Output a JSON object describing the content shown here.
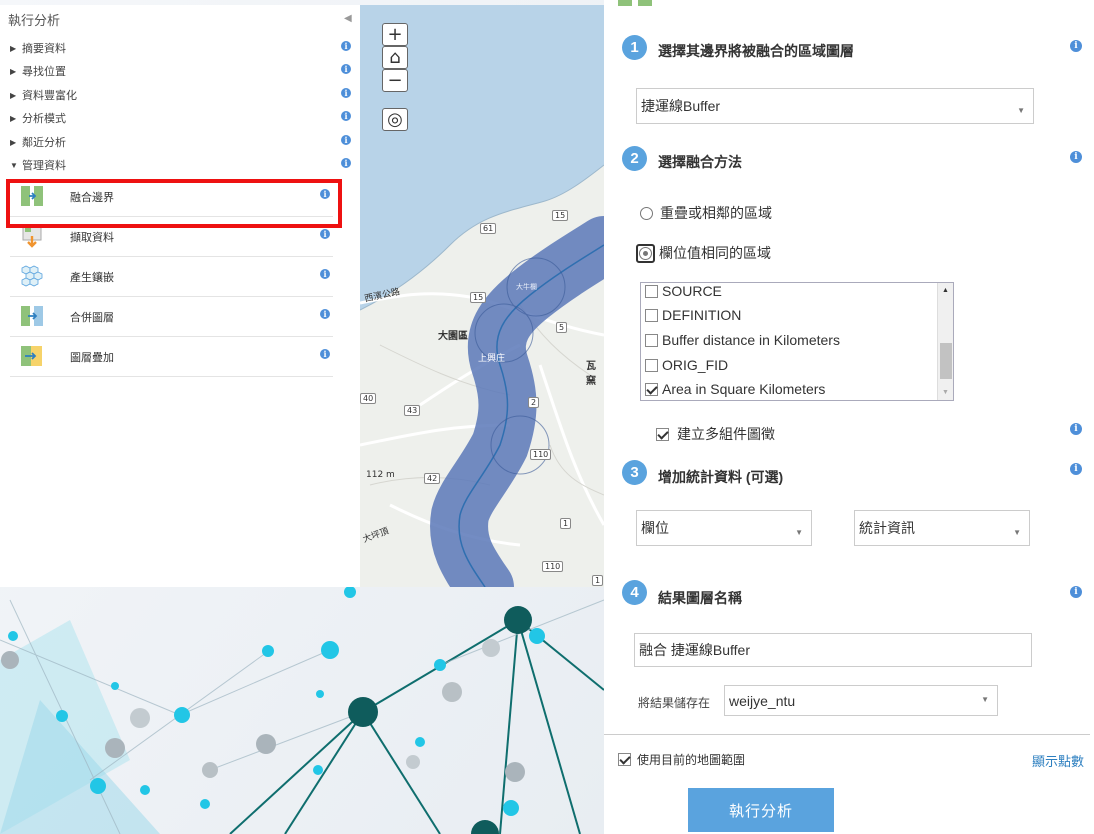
{
  "left_panel": {
    "title": "執行分析",
    "categories": [
      {
        "label": "摘要資料",
        "expanded": false
      },
      {
        "label": "尋找位置",
        "expanded": false
      },
      {
        "label": "資料豐富化",
        "expanded": false
      },
      {
        "label": "分析模式",
        "expanded": false
      },
      {
        "label": "鄰近分析",
        "expanded": false
      },
      {
        "label": "管理資料",
        "expanded": true
      }
    ],
    "tools": [
      {
        "label": "融合邊界",
        "icon": "dissolve-boundaries-icon"
      },
      {
        "label": "擷取資料",
        "icon": "extract-data-icon"
      },
      {
        "label": "產生鑲嵌",
        "icon": "generate-tessellation-icon"
      },
      {
        "label": "合併圖層",
        "icon": "merge-layers-icon"
      },
      {
        "label": "圖層疊加",
        "icon": "overlay-layers-icon"
      }
    ],
    "highlighted_tool": "融合邊界",
    "highlight_color": "#ee1111"
  },
  "map": {
    "controls": {
      "zoom_in": "+",
      "home": "⌂",
      "zoom_out": "−",
      "locate": "◎"
    },
    "labels": {
      "place1": "大園區",
      "place2": "上興庄",
      "place3": "瓦窯",
      "elevation": "112 m",
      "road_west": "西濱公路",
      "village": "大坪頂",
      "misc": "大牛欄",
      "route_61": "61",
      "route_15a": "15",
      "route_15b": "15",
      "route_5": "5",
      "route_2": "2",
      "route_40": "40",
      "route_43": "43",
      "route_110a": "110",
      "route_42": "42",
      "route_1": "1",
      "route_110b": "110",
      "route_1b": "1"
    },
    "buffer_color": "#5a78b8"
  },
  "right_panel": {
    "step1": {
      "num": "1",
      "title": "選擇其邊界將被融合的區域圖層",
      "selected": "捷運線Buffer"
    },
    "step2": {
      "num": "2",
      "title": "選擇融合方法",
      "option1": "重疊或相鄰的區域",
      "option2": "欄位值相同的區域",
      "fields": [
        {
          "label": "SOURCE",
          "checked": false
        },
        {
          "label": "DEFINITION",
          "checked": false
        },
        {
          "label": "Buffer distance in Kilometers",
          "checked": false
        },
        {
          "label": "ORIG_FID",
          "checked": false
        },
        {
          "label": "Area in Square Kilometers",
          "checked": true
        }
      ],
      "multipart_label": "建立多組件圖徵",
      "multipart_checked": true
    },
    "step3": {
      "num": "3",
      "title": "增加統計資料 (可選)",
      "field_placeholder": "欄位",
      "stat_placeholder": "統計資訊"
    },
    "step4": {
      "num": "4",
      "title": "結果圖層名稱",
      "layer_name": "融合 捷運線Buffer",
      "save_label": "將結果儲存在",
      "save_folder": "weijye_ntu"
    },
    "extent_label": "使用目前的地圖範圍",
    "show_credits": "顯示點數",
    "run_button": "執行分析",
    "accent": "#5aa3de"
  },
  "info_glyph": "i"
}
